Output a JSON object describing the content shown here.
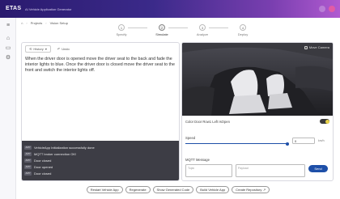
{
  "header": {
    "logo": "ETAS",
    "app_title": "AI Vehicle Application Generator"
  },
  "breadcrumb": {
    "items": [
      "Projects",
      "Vision Setup"
    ]
  },
  "stepper": {
    "steps": [
      {
        "num": "1",
        "label": "Specify"
      },
      {
        "num": "2",
        "label": "Simulate"
      },
      {
        "num": "3",
        "label": "Analyze"
      },
      {
        "num": "4",
        "label": "Deploy"
      }
    ],
    "active_index": 1
  },
  "editor": {
    "history_label": "History",
    "undo_label": "Undo",
    "text": "When the driver door is opened move the driver seat to the back and fade the interior lights to blue. Once the driver door is closed move the driver seat to the front and switch the interior lights off."
  },
  "console": {
    "lines": [
      {
        "tag": "APP",
        "text": "VehicleApp Initialization successfully done"
      },
      {
        "tag": "APP",
        "text": "MQTT broker connection OK!"
      },
      {
        "tag": "APP",
        "text": "Door closed"
      },
      {
        "tag": "APP",
        "text": "Door opened"
      },
      {
        "tag": "APP",
        "text": "Door closed"
      }
    ]
  },
  "simulation": {
    "camera_label": "Move Camera",
    "color_door_label": "Color Door Row1 Left IsOpen",
    "door_open": true,
    "speed_label": "Speed",
    "speed_value": "0",
    "speed_unit": "km/h",
    "mqtt_label": "MQTT Message",
    "topic_placeholder": "Topic",
    "payload_placeholder": "Payload",
    "send_label": "Send"
  },
  "actions": {
    "buttons": [
      "Restart Vehicle App",
      "Regenerate",
      "Show Generated Code",
      "Build Vehicle App",
      "Create Repository"
    ],
    "link_icon": "external-link-icon"
  },
  "colors": {
    "accent": "#1e4fa8",
    "header_start": "#2a1a6e",
    "header_end": "#b05ad0",
    "toggle_knob": "#e8d24a"
  }
}
